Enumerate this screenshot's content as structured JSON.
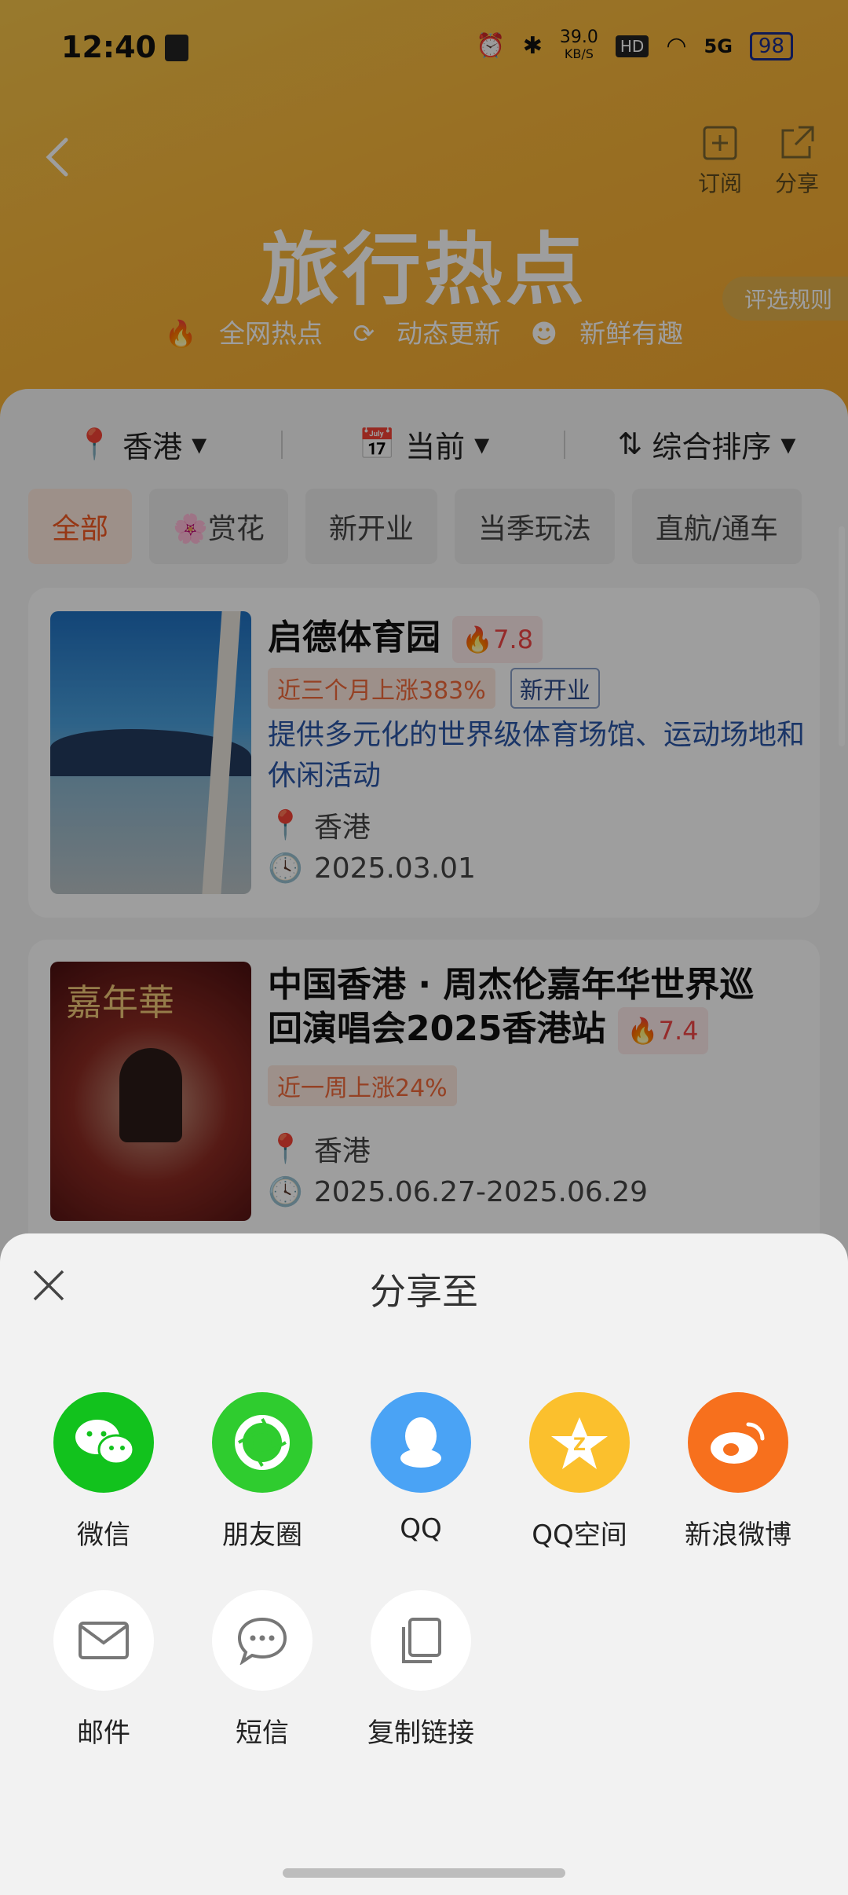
{
  "status_bar": {
    "time": "12:40",
    "speed": "39.0",
    "speed_unit": "KB/S",
    "hd": "HD",
    "network": "5G",
    "battery": "98"
  },
  "header": {
    "title": "旅行热点",
    "tags": [
      "全网热点",
      "动态更新",
      "新鲜有趣"
    ],
    "subscribe_label": "订阅",
    "share_label": "分享",
    "rule_label": "评选规则"
  },
  "filters": {
    "location": "香港",
    "time": "当前",
    "sort": "综合排序"
  },
  "chips": [
    "全部",
    "赏花",
    "新开业",
    "当季玩法",
    "直航/通车"
  ],
  "cards": [
    {
      "title": "启德体育园",
      "heat": "7.8",
      "trend": "近三个月上涨383%",
      "tag": "新开业",
      "desc": "提供多元化的世界级体育场馆、运动场地和休闲活动",
      "location": "香港",
      "date": "2025.03.01"
    },
    {
      "title_line1": "中国香港 · 周杰伦嘉年华世界巡",
      "title_line2": "回演唱会2025香港站",
      "heat": "7.4",
      "trend": "近一周上涨24%",
      "location": "香港",
      "date": "2025.06.27-2025.06.29"
    }
  ],
  "share_sheet": {
    "title": "分享至",
    "row1": [
      {
        "label": "微信",
        "icon": "wechat-icon",
        "color": "#12c21d"
      },
      {
        "label": "朋友圈",
        "icon": "moments-icon",
        "color": "#2fcc2f"
      },
      {
        "label": "QQ",
        "icon": "qq-icon",
        "color": "#4aa3f5"
      },
      {
        "label": "QQ空间",
        "icon": "qzone-icon",
        "color": "#fbc02d"
      },
      {
        "label": "新浪微博",
        "icon": "weibo-icon",
        "color": "#f7701d"
      }
    ],
    "row2": [
      {
        "label": "邮件",
        "icon": "mail-icon",
        "color": "#ffffff"
      },
      {
        "label": "短信",
        "icon": "sms-icon",
        "color": "#ffffff"
      },
      {
        "label": "复制链接",
        "icon": "copy-link-icon",
        "color": "#ffffff"
      }
    ]
  }
}
